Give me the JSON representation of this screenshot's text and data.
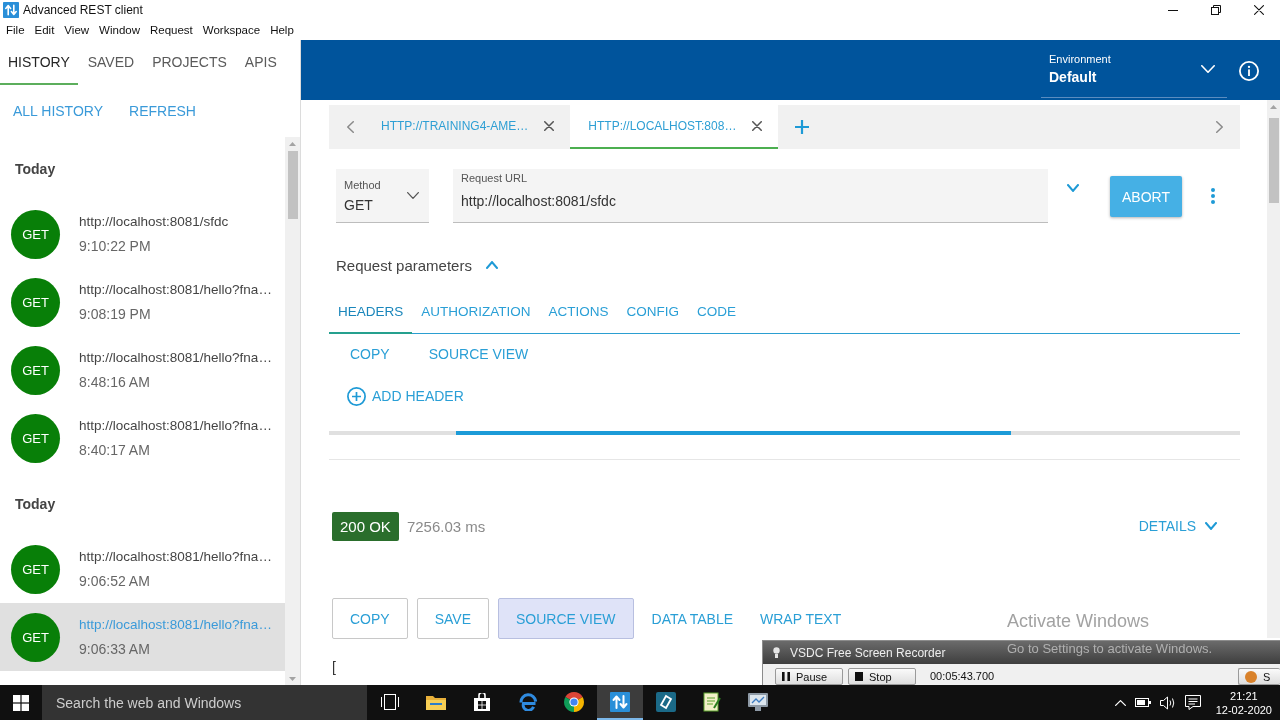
{
  "window": {
    "title": "Advanced REST client"
  },
  "menu": [
    "File",
    "Edit",
    "View",
    "Window",
    "Request",
    "Workspace",
    "Help"
  ],
  "sidebar": {
    "tabs": [
      {
        "label": "HISTORY",
        "selected": true
      },
      {
        "label": "SAVED",
        "selected": false
      },
      {
        "label": "PROJECTS",
        "selected": false
      },
      {
        "label": "APIS",
        "selected": false
      }
    ],
    "actions": [
      "ALL HISTORY",
      "REFRESH"
    ],
    "groups": [
      {
        "title": "Today",
        "items": [
          {
            "method": "GET",
            "url": "http://localhost:8081/sfdc",
            "time": "9:10:22 PM",
            "selected": false
          },
          {
            "method": "GET",
            "url": "http://localhost:8081/hello?fna…",
            "time": "9:08:19 PM",
            "selected": false
          },
          {
            "method": "GET",
            "url": "http://localhost:8081/hello?fna…",
            "time": "8:48:16 AM",
            "selected": false
          },
          {
            "method": "GET",
            "url": "http://localhost:8081/hello?fna…",
            "time": "8:40:17 AM",
            "selected": false
          }
        ]
      },
      {
        "title": "Today",
        "items": [
          {
            "method": "GET",
            "url": "http://localhost:8081/hello?fna…",
            "time": "9:06:52 AM",
            "selected": false
          },
          {
            "method": "GET",
            "url": "http://localhost:8081/hello?fna…",
            "time": "9:06:33 AM",
            "selected": true
          }
        ]
      }
    ]
  },
  "environment": {
    "label": "Environment",
    "value": "Default"
  },
  "request_tabs": [
    {
      "label": "HTTP://TRAINING4-AME…",
      "selected": false
    },
    {
      "label": "HTTP://LOCALHOST:808…",
      "selected": true
    }
  ],
  "request": {
    "method": {
      "label": "Method",
      "value": "GET"
    },
    "url": {
      "label": "Request URL",
      "value": "http://localhost:8081/sfdc"
    },
    "action": "ABORT"
  },
  "parameters": {
    "title": "Request parameters",
    "expanded": true,
    "tabs": [
      {
        "label": "HEADERS",
        "selected": true
      },
      {
        "label": "AUTHORIZATION",
        "selected": false
      },
      {
        "label": "ACTIONS",
        "selected": false
      },
      {
        "label": "CONFIG",
        "selected": false
      },
      {
        "label": "CODE",
        "selected": false
      }
    ],
    "actions": [
      "COPY",
      "SOURCE VIEW"
    ],
    "add_header": "ADD HEADER"
  },
  "progress": {
    "indeterminate": true
  },
  "response": {
    "status": "200 OK",
    "duration": "7256.03 ms",
    "details": "DETAILS",
    "buttons": [
      {
        "label": "COPY",
        "kind": "outlined",
        "selected": false
      },
      {
        "label": "SAVE",
        "kind": "outlined",
        "selected": false
      },
      {
        "label": "SOURCE VIEW",
        "kind": "outlined",
        "selected": true
      },
      {
        "label": "DATA TABLE",
        "kind": "text",
        "selected": false
      },
      {
        "label": "WRAP TEXT",
        "kind": "text",
        "selected": false
      }
    ],
    "body": "["
  },
  "recorder": {
    "title": "VSDC Free Screen Recorder",
    "buttons": [
      {
        "label": "Pause",
        "kind": "pause"
      },
      {
        "label": "Stop",
        "kind": "stop"
      }
    ],
    "elapsed": "00:05:43.700",
    "button_3": "S"
  },
  "activation_notice": {
    "title": "Activate Windows",
    "text": "Go to Settings to activate Windows."
  },
  "taskbar": {
    "search": {
      "placeholder": "Search the web and Windows"
    },
    "apps": [
      {
        "kind": "task-view",
        "active": false
      },
      {
        "kind": "folder",
        "active": false
      },
      {
        "kind": "store",
        "active": false
      },
      {
        "kind": "edge",
        "active": false
      },
      {
        "kind": "chrome",
        "active": false
      },
      {
        "kind": "arc",
        "active": true
      },
      {
        "kind": "vsdc",
        "active": false
      },
      {
        "kind": "notepad",
        "active": false
      },
      {
        "kind": "monitor",
        "active": false
      }
    ],
    "clock": {
      "time": "21:21",
      "date": "12-02-2020"
    }
  }
}
